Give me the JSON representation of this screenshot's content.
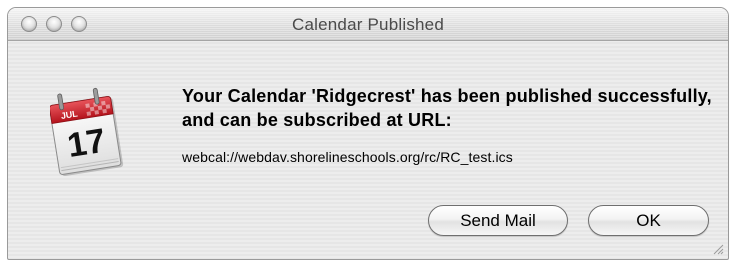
{
  "window": {
    "title": "Calendar Published",
    "controls": [
      "close",
      "minimize",
      "zoom"
    ]
  },
  "icon": {
    "name": "ical-calendar-icon",
    "month": "JUL",
    "day": "17"
  },
  "message": {
    "headline": "Your Calendar 'Ridgecrest' has been published successfully, and can be subscribed at URL:",
    "url": "webcal://webdav.shorelineschools.org/rc/RC_test.ics"
  },
  "buttons": {
    "send_mail": "Send Mail",
    "ok": "OK"
  },
  "colors": {
    "calendar_red": "#c8202a",
    "window_bg": "#ececec"
  }
}
